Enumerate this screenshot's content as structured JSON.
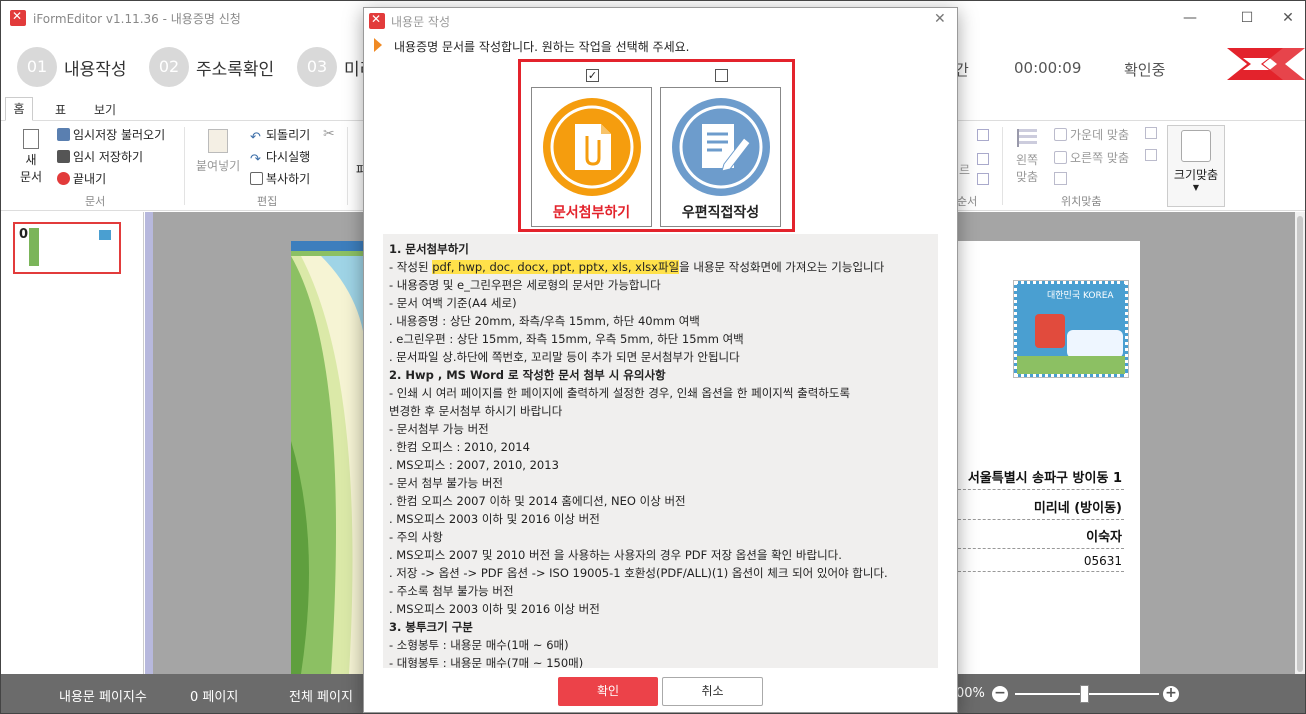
{
  "app": {
    "title": "iFormEditor v1.11.36 - 내용증명 신청",
    "minimize": "—",
    "maximize": "☐",
    "close": "✕"
  },
  "steps": [
    {
      "num": "01",
      "label": "내용작성"
    },
    {
      "num": "02",
      "label": "주소록확인"
    },
    {
      "num": "03",
      "label": "미리"
    }
  ],
  "header_right": {
    "time_label": "간",
    "timer": "00:00:09",
    "status": "확인중"
  },
  "ribbon": {
    "tabs": [
      "홈",
      "표",
      "보기"
    ],
    "new_doc": "새\n문서",
    "new_doc_1": "새",
    "new_doc_2": "문서",
    "load_temp": "임시저장 불러오기",
    "temp_save": "임시 저장하기",
    "exit": "끝내기",
    "group_doc": "문서",
    "paste": "붙여넣기",
    "undo": "되돌리기",
    "redo": "다시실행",
    "copy": "복사하기",
    "group_edit": "편집",
    "partial_p": "파",
    "partial_r": "르",
    "partial_order": "순서",
    "align_center": "가운데 맞춤",
    "align_right": "오른쪽 맞춤",
    "align_left_1": "왼쪽",
    "align_left_2": "맞춤",
    "group_pos": "위치맞춤",
    "fit_size": "크기맞춤"
  },
  "thumbnail": {
    "number": "0"
  },
  "envelope": {
    "stamp_text": "대한민국 KOREA",
    "address1": "서울특별시 송파구 방이동 1",
    "address2": "미리네 (방이동)",
    "name": "이숙자",
    "zip": "05631"
  },
  "statusbar": {
    "pages_label": "내용문 페이지수",
    "pages_value": "0 페이지",
    "total_label": "전체 페이지",
    "zoom": "00%",
    "zoom_level_fraction": 0.48
  },
  "dialog": {
    "title": "내용문 작성",
    "close": "✕",
    "prompt": "내용증명 문서를 작성합니다. 원하는 작업을 선택해 주세요.",
    "options": [
      {
        "label": "문서첨부하기",
        "checked": true,
        "color": "#f59d0e"
      },
      {
        "label": "우편직접작성",
        "checked": false,
        "color": "#6d9ccc"
      }
    ],
    "check_mark": "✓",
    "info": {
      "s1_title": "1. 문서첨부하기",
      "s1_l1_pre": " - 작성된 ",
      "s1_l1_hl": "pdf, hwp, doc, docx, ppt, pptx, xls, xlsx파일",
      "s1_l1_post": "을 내용문 작성화면에 가져오는 기능입니다",
      "s1_l2": " - 내용증명 및 e_그린우편은 세로형의 문서만 가능합니다",
      "s1_l3": " - 문서 여백 기준(A4 세로)",
      "s1_l4": "  . 내용증명  : 상단 20mm, 좌측/우측 15mm, 하단 40mm 여백",
      "s1_l5": "  . e그린우편 : 상단 15mm, 좌측 15mm, 우측 5mm, 하단 15mm 여백",
      "s1_l6": "  . 문서파일 상.하단에 쪽번호, 꼬리말 등이 추가 되면 문서첨부가 안됩니다",
      "s2_title": "2. Hwp , MS Word 로 작성한 문서 첨부 시  유의사항",
      "s2_l1": " - 인쇄 시 여러 페이지를 한 페이지에  출력하게 설정한 경우, 인쇄 옵션을 한 페이지씩 출력하도록",
      "s2_l2": "   변경한 후 문서첨부 하시기 바랍니다",
      "s2_l3": " - 문서첨부 가능 버전",
      "s2_l4": "  . 한컴 오피스 : 2010, 2014",
      "s2_l5": "  . MS오피스 : 2007, 2010, 2013",
      "s2_l6": " - 문서 첨부 불가능 버전",
      "s2_l7": "  . 한컴 오피스 2007 이하 및 2014 홈에디션, NEO 이상 버전",
      "s2_l8": "  . MS오피스 2003 이하 및 2016 이상 버전",
      "s2_l9": " - 주의 사항",
      "s2_l10": "  . MS오피스 2007 및 2010 버전 을 사용하는 사용자의 경우 PDF 저장 옵션을 확인 바랍니다.",
      "s2_l11": "  . 저장 -> 옵션 -> PDF 옵션 -> ISO 19005-1 호환성(PDF/ALL)(1) 옵션이 체크 되어 있어야 합니다.",
      "s2_l12": " - 주소록 첨부 불가능 버전",
      "s2_l13": "  . MS오피스 2003 이하 및 2016 이상 버전",
      "s3_title": "3. 봉투크기 구분",
      "s3_l1": " - 소형봉투 : 내용문 매수(1매 ~ 6매)",
      "s3_l2": " - 대형봉투 : 내용문 매수(7매 ~ 150매)"
    },
    "ok": "확인",
    "cancel": "취소"
  },
  "colors": {
    "accent": "#e3232c",
    "ok_button": "#ec4249",
    "highlight": "#ffe14a"
  }
}
